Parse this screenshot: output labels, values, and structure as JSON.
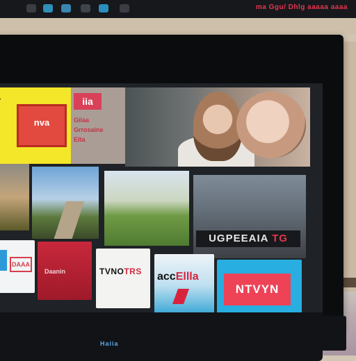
{
  "status_bar": {
    "icons": [
      "screen-icon",
      "cast-icon",
      "mail-icon",
      "bell-icon",
      "clock-icon",
      "user-icon"
    ],
    "text": "ma Ggu/ Dhlg aaaaa aaaa"
  },
  "tv": {
    "brand": "Haiia"
  },
  "hero": {
    "yellow_tile": {
      "mark": "•",
      "badge": "nva"
    },
    "promo_tile": {
      "logo": "iia",
      "lines": "Gilaa\nGrrosaine\nElta"
    },
    "featured_image": "two-faces-still"
  },
  "middle_row": {
    "tiles": [
      "landscape-tile-1",
      "landscape-tile-2",
      "field-tile",
      "feature-tile"
    ],
    "feature_wordmark": {
      "main": "UGPEEAIA",
      "accent": "TG"
    }
  },
  "app_row": {
    "apps": [
      {
        "name": "app-1",
        "label": "DAAA"
      },
      {
        "name": "app-2",
        "label": "Daanin"
      },
      {
        "name": "app-3",
        "label_main": "TVNO",
        "label_accent": "TRS"
      },
      {
        "name": "app-4",
        "label_main": "acc",
        "label_accent": "Ellla"
      },
      {
        "name": "app-5",
        "label": "NTVYN"
      }
    ]
  },
  "colors": {
    "accent_red": "#e24a3f",
    "yellow": "#f4e628",
    "cyan": "#28aee0"
  }
}
